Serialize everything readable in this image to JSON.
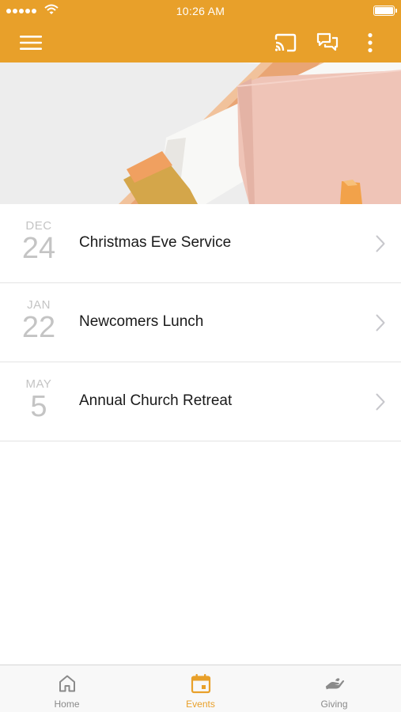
{
  "status_bar": {
    "time": "10:26 AM"
  },
  "header": {
    "icons": [
      "menu-icon",
      "cast-icon",
      "chat-icon",
      "more-vertical-icon"
    ]
  },
  "colors": {
    "accent": "#e8a02a",
    "text": "#1a1a1a",
    "date_gray": "#c4c4c4",
    "tab_inactive": "#8a8a8a"
  },
  "events": [
    {
      "month": "DEC",
      "day": "24",
      "title": "Christmas Eve Service"
    },
    {
      "month": "JAN",
      "day": "22",
      "title": "Newcomers Lunch"
    },
    {
      "month": "MAY",
      "day": "5",
      "title": "Annual Church Retreat"
    }
  ],
  "tabs": [
    {
      "label": "Home",
      "icon": "home-icon",
      "active": false
    },
    {
      "label": "Events",
      "icon": "calendar-icon",
      "active": true
    },
    {
      "label": "Giving",
      "icon": "giving-hand-icon",
      "active": false
    }
  ]
}
